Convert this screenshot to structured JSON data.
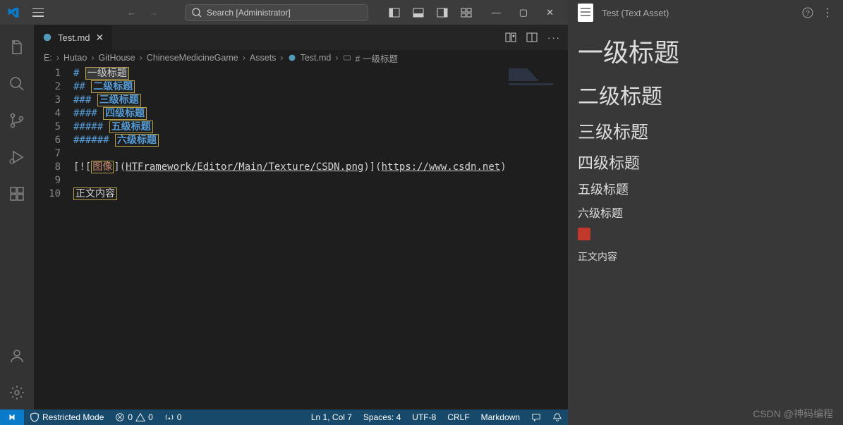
{
  "titlebar": {
    "search_placeholder": "Search [Administrator]"
  },
  "tab": {
    "filename": "Test.md"
  },
  "breadcrumb": {
    "segments": [
      "E:",
      "Hutao",
      "GitHouse",
      "ChineseMedicineGame",
      "Assets",
      "Test.md",
      "# 一级标题"
    ]
  },
  "editor": {
    "lines": [
      {
        "n": "1",
        "hash": "#",
        "text": "一级标题",
        "style": "h1"
      },
      {
        "n": "2",
        "hash": "##",
        "text": "二级标题",
        "style": "hn"
      },
      {
        "n": "3",
        "hash": "###",
        "text": "三级标题",
        "style": "hn"
      },
      {
        "n": "4",
        "hash": "####",
        "text": "四级标题",
        "style": "hn"
      },
      {
        "n": "5",
        "hash": "#####",
        "text": "五级标题",
        "style": "hn"
      },
      {
        "n": "6",
        "hash": "######",
        "text": "六级标题",
        "style": "hn"
      }
    ],
    "empty7": "7",
    "line8": {
      "n": "8",
      "open": "[![",
      "alt": "图像",
      "mid1": "](",
      "path": "HTFramework/Editor/Main/Texture/CSDN.png",
      "mid2": ")](",
      "url": "https://www.csdn.net",
      "close": ")"
    },
    "empty9": "9",
    "line10": {
      "n": "10",
      "text": "正文内容"
    }
  },
  "statusbar": {
    "restricted": "Restricted Mode",
    "errors": "0",
    "warnings": "0",
    "ports": "0",
    "ln_col": "Ln 1, Col 7",
    "spaces": "Spaces: 4",
    "encoding": "UTF-8",
    "eol": "CRLF",
    "lang": "Markdown"
  },
  "preview": {
    "title": "Test (Text Asset)",
    "h1": "一级标题",
    "h2": "二级标题",
    "h3": "三级标题",
    "h4": "四级标题",
    "h5": "五级标题",
    "h6": "六级标题",
    "body": "正文内容"
  },
  "watermark": "CSDN @神码编程"
}
